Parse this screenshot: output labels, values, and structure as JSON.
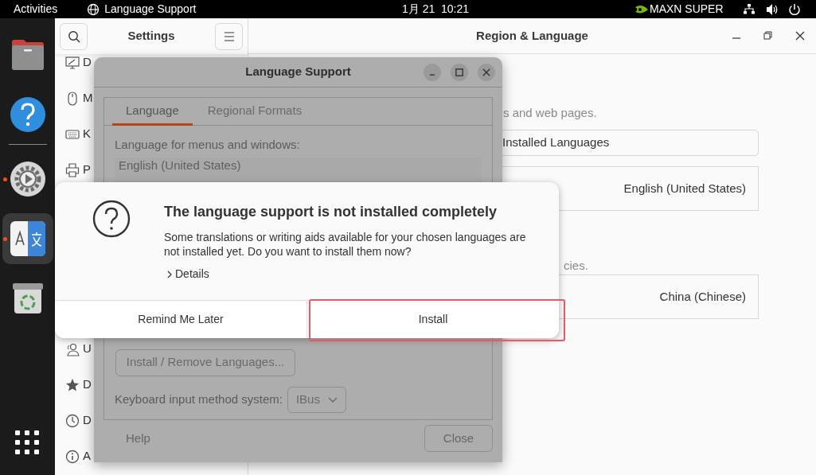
{
  "top_bar": {
    "activities": "Activities",
    "app_name": "Language Support",
    "clock": "1月 21  10:21",
    "power_mode": "MAXN SUPER"
  },
  "dock": {
    "items": [
      {
        "kind": "files",
        "running": false,
        "selected": false
      },
      {
        "kind": "help",
        "running": false,
        "selected": false
      },
      {
        "kind": "settings",
        "running": true,
        "selected": false
      },
      {
        "kind": "language",
        "running": true,
        "selected": true
      },
      {
        "kind": "trash",
        "running": false,
        "selected": false
      }
    ]
  },
  "settings": {
    "title": "Settings",
    "sidebar": [
      {
        "kind": "display",
        "label": "D"
      },
      {
        "kind": "mouse",
        "label": "M"
      },
      {
        "kind": "keyboard",
        "label": "K"
      },
      {
        "kind": "printer",
        "label": "P"
      },
      {
        "kind": "users",
        "label": "U"
      },
      {
        "kind": "star",
        "label": "D"
      },
      {
        "kind": "clock",
        "label": "D"
      },
      {
        "kind": "info",
        "label": "A"
      }
    ],
    "panel_title": "Region & Language",
    "language_hint": "s and web pages.",
    "installed_languages": "Installed Languages",
    "language_value": "English (United States)",
    "formats_hint": "cies.",
    "formats_value": "China (Chinese)"
  },
  "language_support": {
    "title": "Language Support",
    "tabs": [
      {
        "label": "Language",
        "selected": true
      },
      {
        "label": "Regional Formats",
        "selected": false
      }
    ],
    "list_label": "Language for menus and windows:",
    "languages": [
      "English (United States)"
    ],
    "install_remove_button": "Install / Remove Languages...",
    "input_method_label": "Keyboard input method system:",
    "input_method_value": "IBus",
    "help_button": "Help",
    "close_button": "Close"
  },
  "alert": {
    "title": "The language support is not installed completely",
    "message": "Some translations or writing aids available for your chosen languages are not installed yet. Do you want to install them now?",
    "details": "Details",
    "buttons": [
      {
        "label": "Remind Me Later",
        "highlighted": false
      },
      {
        "label": "Install",
        "highlighted": true
      }
    ]
  }
}
